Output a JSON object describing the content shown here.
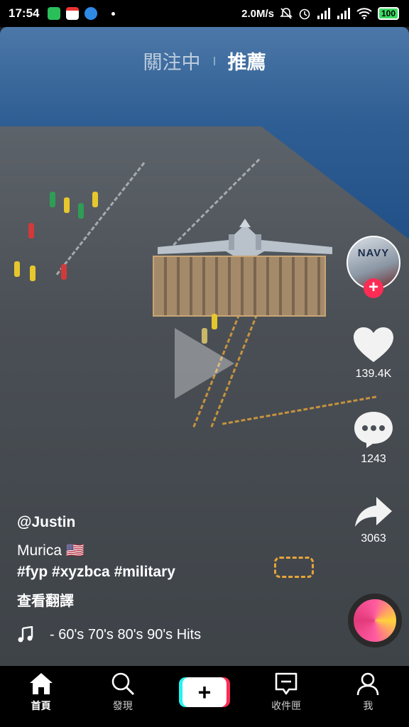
{
  "status_bar": {
    "time": "17:54",
    "network_speed": "2.0M/s",
    "battery": "100"
  },
  "top_tabs": [
    {
      "label": "關注中",
      "active": false
    },
    {
      "label": "推薦",
      "active": true
    }
  ],
  "creator": {
    "avatar_text": "NAVY"
  },
  "actions": {
    "likes": "139.4K",
    "comments": "1243",
    "shares": "3063"
  },
  "post": {
    "username": "@Justin",
    "description": "Murica 🇺🇸",
    "hashtags": "#fyp #xyzbca #military",
    "translate_label": "查看翻譯",
    "music": "- 60's 70's 80's 90's Hits"
  },
  "bottom_nav": [
    {
      "label": "首頁",
      "icon": "home-icon",
      "active": true
    },
    {
      "label": "發現",
      "icon": "search-icon",
      "active": false
    },
    {
      "label": "",
      "icon": "plus-icon",
      "active": false
    },
    {
      "label": "收件匣",
      "icon": "inbox-icon",
      "active": false
    },
    {
      "label": "我",
      "icon": "profile-icon",
      "active": false
    }
  ],
  "colors": {
    "accent_red": "#fe2c55",
    "accent_cyan": "#25f4ee"
  }
}
